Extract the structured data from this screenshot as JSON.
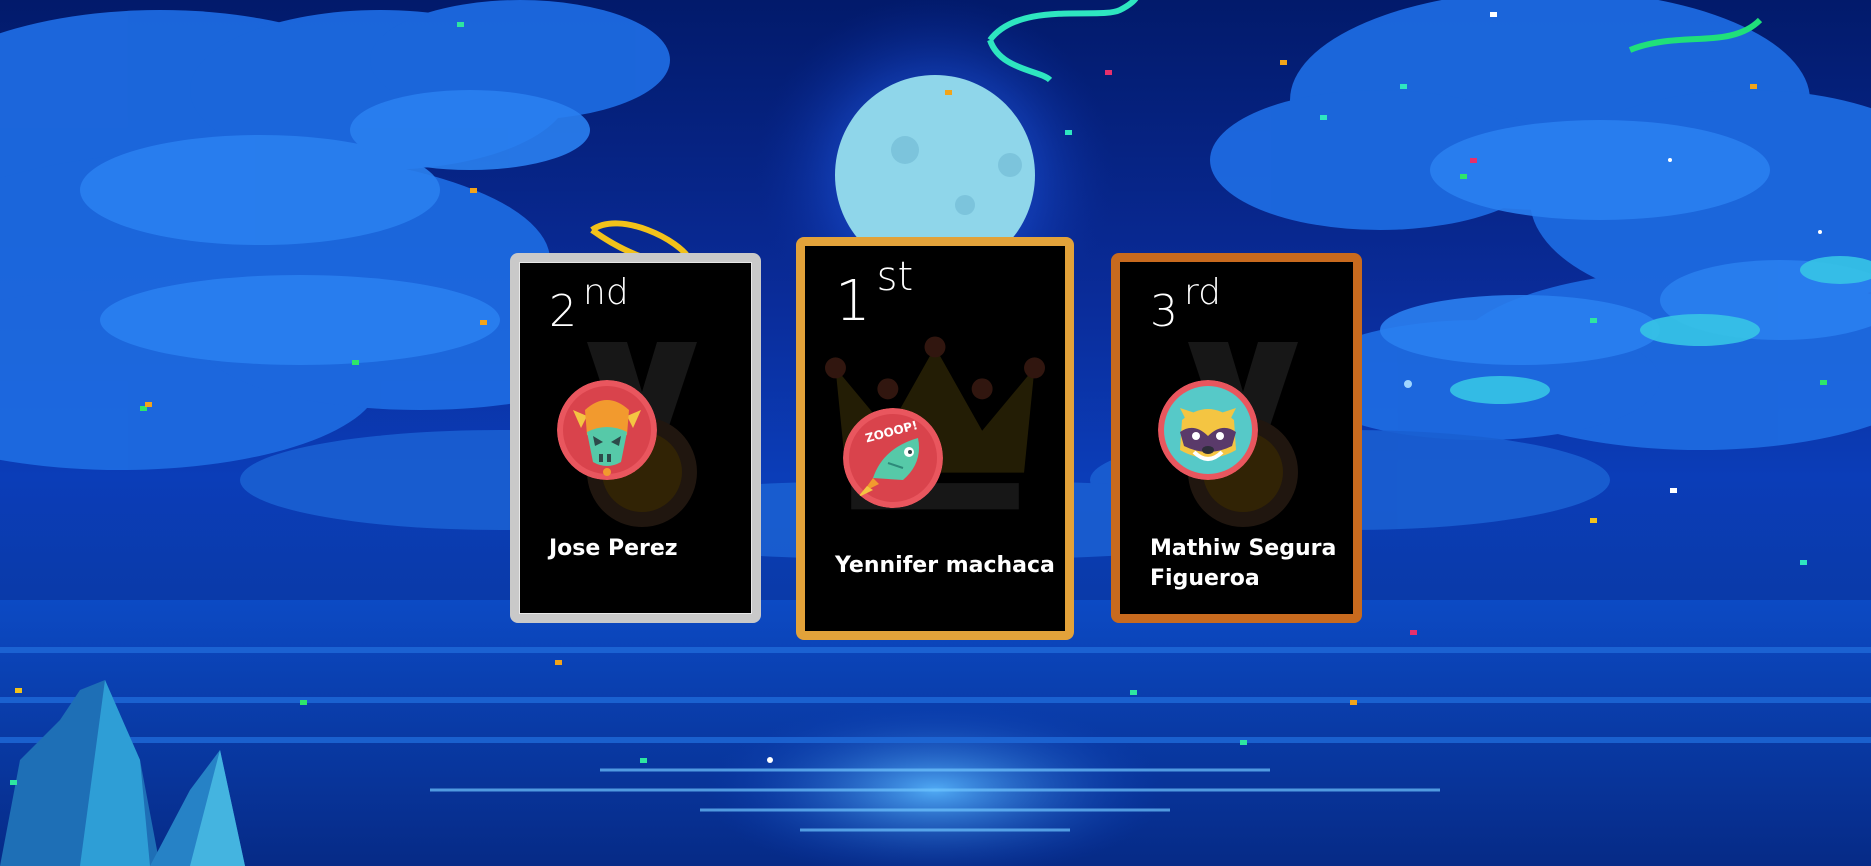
{
  "leaderboard": {
    "entries": [
      {
        "place_number": "2",
        "place_suffix": "nd",
        "name": "Jose Perez",
        "avatar_icon": "green-skull-monster-icon",
        "medal": "silver"
      },
      {
        "place_number": "1",
        "place_suffix": "st",
        "name": "Yennifer machaca",
        "avatar_icon": "rocket-fish-zooop-icon",
        "medal": "gold"
      },
      {
        "place_number": "3",
        "place_suffix": "rd",
        "name": "Mathiw Segura Figueroa",
        "avatar_icon": "raccoon-mask-icon",
        "medal": "bronze"
      }
    ]
  },
  "background": {
    "theme": "night-sky-ocean-with-moon-and-confetti",
    "icons": [
      "moon-icon",
      "cloud-icon",
      "rock-cliff-icon",
      "confetti-icon",
      "streamer-icon"
    ]
  },
  "colors": {
    "silver": "#c9c9c9",
    "gold": "#e2a23a",
    "bronze": "#c86a1e",
    "card_bg": "#000000",
    "sky_top": "#021a6b",
    "sky_mid": "#0b3db8"
  }
}
